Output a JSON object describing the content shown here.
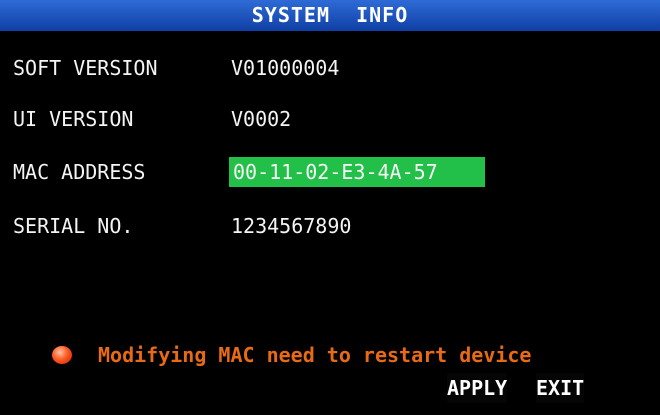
{
  "window": {
    "title": "SYSTEM  INFO"
  },
  "fields": {
    "soft_version": {
      "label": "SOFT VERSION",
      "value": "V01000004"
    },
    "ui_version": {
      "label": "UI VERSION",
      "value": "V0002"
    },
    "mac_address": {
      "label": "MAC ADDRESS",
      "value": "00-11-02-E3-4A-57"
    },
    "serial_no": {
      "label": "SERIAL NO.",
      "value": "1234567890"
    }
  },
  "notice": {
    "icon": "warning-dot-icon",
    "text": "Modifying MAC need to restart device"
  },
  "buttons": {
    "apply": "APPLY",
    "exit": "EXIT"
  },
  "colors": {
    "title_bar": "#1f56c4",
    "mac_field_bg": "#22c048",
    "notice_text": "#e86a14",
    "warning_dot": "#ff5a1f",
    "background": "#000000"
  }
}
